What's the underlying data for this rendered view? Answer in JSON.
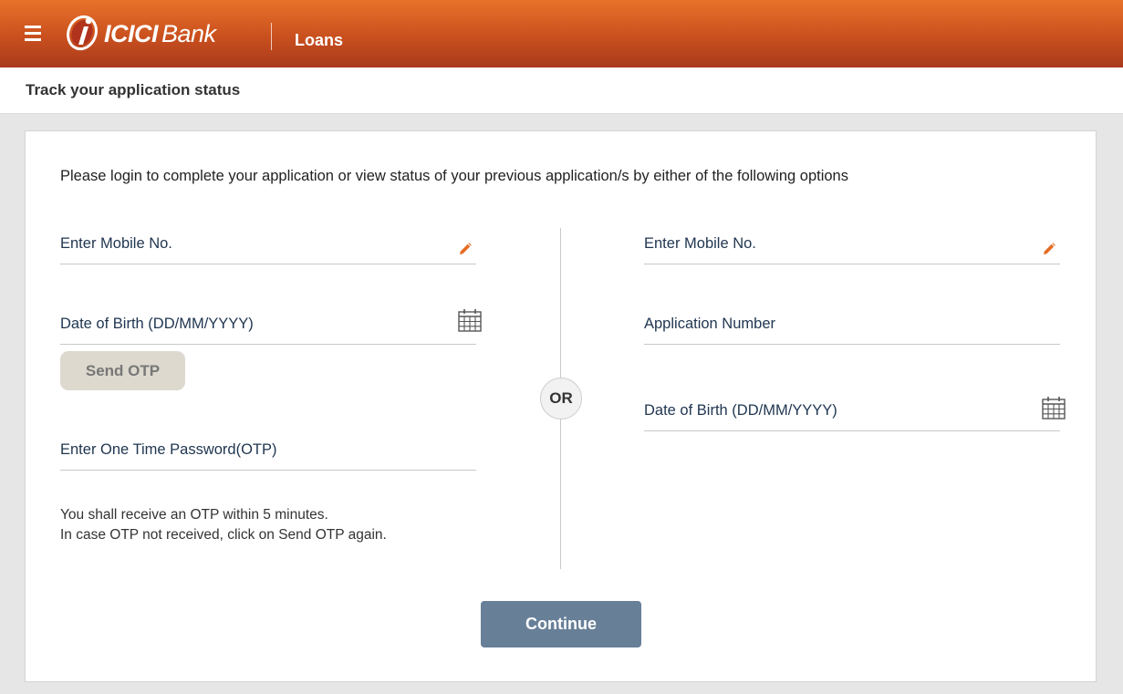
{
  "header": {
    "brand_text_bold": "ICICI",
    "brand_text_regular": "Bank",
    "section": "Loans"
  },
  "page": {
    "title": "Track your application status",
    "intro": "Please login to complete your application or view status of your previous application/s by either of the following options"
  },
  "left_form": {
    "mobile_label": "Enter Mobile No.",
    "dob_label": "Date of Birth (DD/MM/YYYY)",
    "send_otp_label": "Send OTP",
    "otp_label": "Enter One Time Password(OTP)",
    "note_line1": "You shall receive an OTP within 5 minutes.",
    "note_line2": "In case OTP not received, click on Send OTP again."
  },
  "divider": {
    "or_label": "OR"
  },
  "right_form": {
    "mobile_label": "Enter Mobile No.",
    "application_label": "Application Number",
    "dob_label": "Date of Birth (DD/MM/YYYY)"
  },
  "actions": {
    "continue_label": "Continue"
  },
  "colors": {
    "header_top": "#e9722a",
    "header_bottom": "#a93a1c",
    "accent_orange": "#e46c26",
    "continue_button": "#687f98",
    "send_otp_button": "#ddd9ce"
  },
  "icons": {
    "menu": "menu-icon",
    "edit": "pencil-icon",
    "calendar": "calendar-icon"
  }
}
